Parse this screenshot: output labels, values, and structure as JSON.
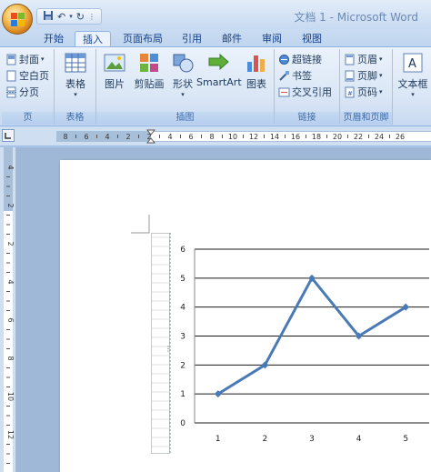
{
  "window": {
    "title": "文档 1 - Microsoft Word"
  },
  "tabs": [
    {
      "label": "开始"
    },
    {
      "label": "插入",
      "active": true
    },
    {
      "label": "页面布局"
    },
    {
      "label": "引用"
    },
    {
      "label": "邮件"
    },
    {
      "label": "审阅"
    },
    {
      "label": "视图"
    }
  ],
  "ribbon": {
    "pages": {
      "cover_label": "封面",
      "blank_label": "空白页",
      "break_label": "分页",
      "group_label": "页"
    },
    "tables": {
      "table_label": "表格",
      "group_label": "表格"
    },
    "illustrations": {
      "picture_label": "图片",
      "clipart_label": "剪贴画",
      "shapes_label": "形状",
      "smartart_label": "SmartArt",
      "chart_label": "图表",
      "group_label": "插图"
    },
    "links": {
      "hyperlink_label": "超链接",
      "bookmark_label": "书签",
      "crossref_label": "交叉引用",
      "group_label": "链接"
    },
    "header_footer": {
      "header_label": "页眉",
      "footer_label": "页脚",
      "pagenum_label": "页码",
      "group_label": "页眉和页脚"
    },
    "text": {
      "textbox_label": "文本框"
    }
  },
  "hruler": {
    "labels": [
      "8",
      "6",
      "4",
      "2",
      "2",
      "4",
      "6",
      "8",
      "10",
      "12",
      "14",
      "16",
      "18",
      "20",
      "22",
      "24",
      "26"
    ]
  },
  "vruler": {
    "labels": [
      "4",
      "2",
      "2",
      "4",
      "6",
      "8",
      "10",
      "12"
    ]
  },
  "chart_data": {
    "type": "line",
    "categories": [
      "1",
      "2",
      "3",
      "4",
      "5"
    ],
    "series": [
      {
        "values": [
          1,
          2,
          5,
          3,
          4
        ],
        "color": "#4a7ab5"
      }
    ],
    "ylim": [
      0,
      6
    ],
    "yticks": [
      "0",
      "1",
      "2",
      "3",
      "4",
      "5",
      "6"
    ],
    "grid": true
  },
  "colors": {
    "accent": "#15428b",
    "series_line": "#4a7ab5"
  }
}
